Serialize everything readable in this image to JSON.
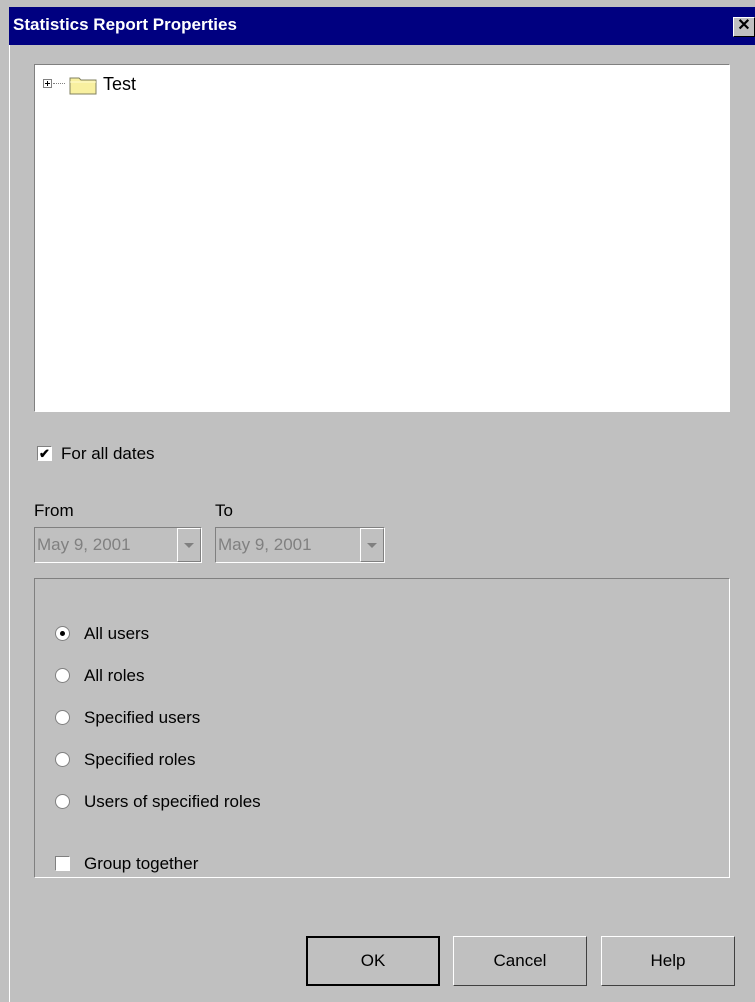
{
  "window": {
    "title": "Statistics Report Properties",
    "close_glyph": "✕"
  },
  "tree": {
    "root_label": "Test",
    "expander_icon": "plus-box-icon",
    "folder_icon": "folder-icon"
  },
  "dates": {
    "all_dates_label": "For all dates",
    "all_dates_checked": true,
    "from_label": "From",
    "to_label": "To",
    "from_value": "May 9, 2001",
    "to_value": "May 9, 2001"
  },
  "scope": {
    "options": [
      {
        "label": "All users",
        "selected": true
      },
      {
        "label": "All roles",
        "selected": false
      },
      {
        "label": "Specified users",
        "selected": false
      },
      {
        "label": "Specified roles",
        "selected": false
      },
      {
        "label": "Users of specified roles",
        "selected": false
      }
    ],
    "group_together_label": "Group together",
    "group_together_checked": false
  },
  "buttons": {
    "ok": "OK",
    "cancel": "Cancel",
    "help": "Help"
  },
  "colors": {
    "titlebar": "#000080",
    "face": "#c0c0c0",
    "disabled_text": "#808080"
  }
}
